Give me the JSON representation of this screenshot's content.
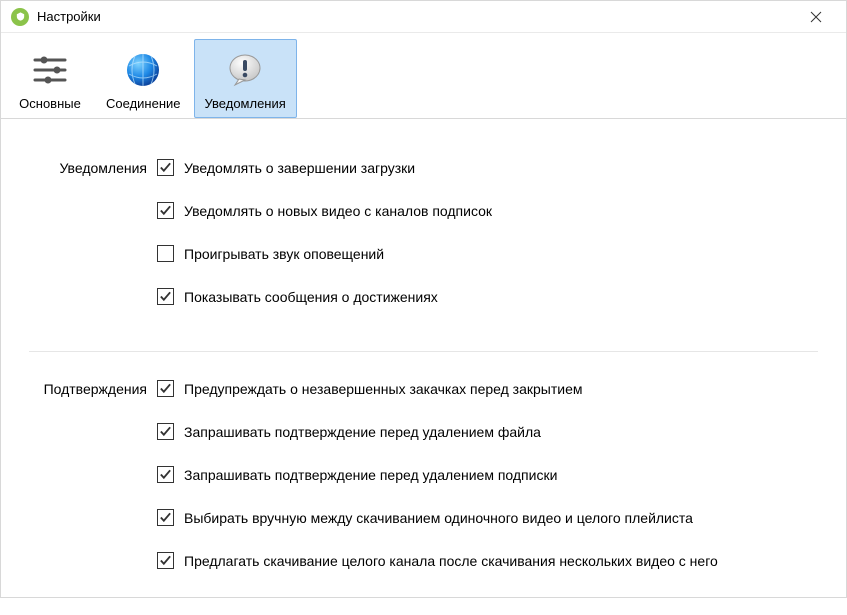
{
  "window": {
    "title": "Настройки"
  },
  "tabs": {
    "items": [
      {
        "label": "Основные"
      },
      {
        "label": "Соединение"
      },
      {
        "label": "Уведомления"
      }
    ],
    "active_index": 2
  },
  "sections": {
    "notifications": {
      "title": "Уведомления",
      "items": [
        {
          "label": "Уведомлять о завершении загрузки",
          "checked": true
        },
        {
          "label": "Уведомлять о новых видео с каналов подписок",
          "checked": true
        },
        {
          "label": "Проигрывать звук оповещений",
          "checked": false
        },
        {
          "label": "Показывать сообщения о достижениях",
          "checked": true
        }
      ]
    },
    "confirmations": {
      "title": "Подтверждения",
      "items": [
        {
          "label": "Предупреждать о незавершенных закачках перед закрытием",
          "checked": true
        },
        {
          "label": "Запрашивать подтверждение перед удалением файла",
          "checked": true
        },
        {
          "label": "Запрашивать подтверждение перед удалением подписки",
          "checked": true
        },
        {
          "label": "Выбирать вручную между скачиванием одиночного видео и целого плейлиста",
          "checked": true
        },
        {
          "label": "Предлагать скачивание целого канала после скачивания нескольких видео с него",
          "checked": true
        }
      ]
    }
  }
}
